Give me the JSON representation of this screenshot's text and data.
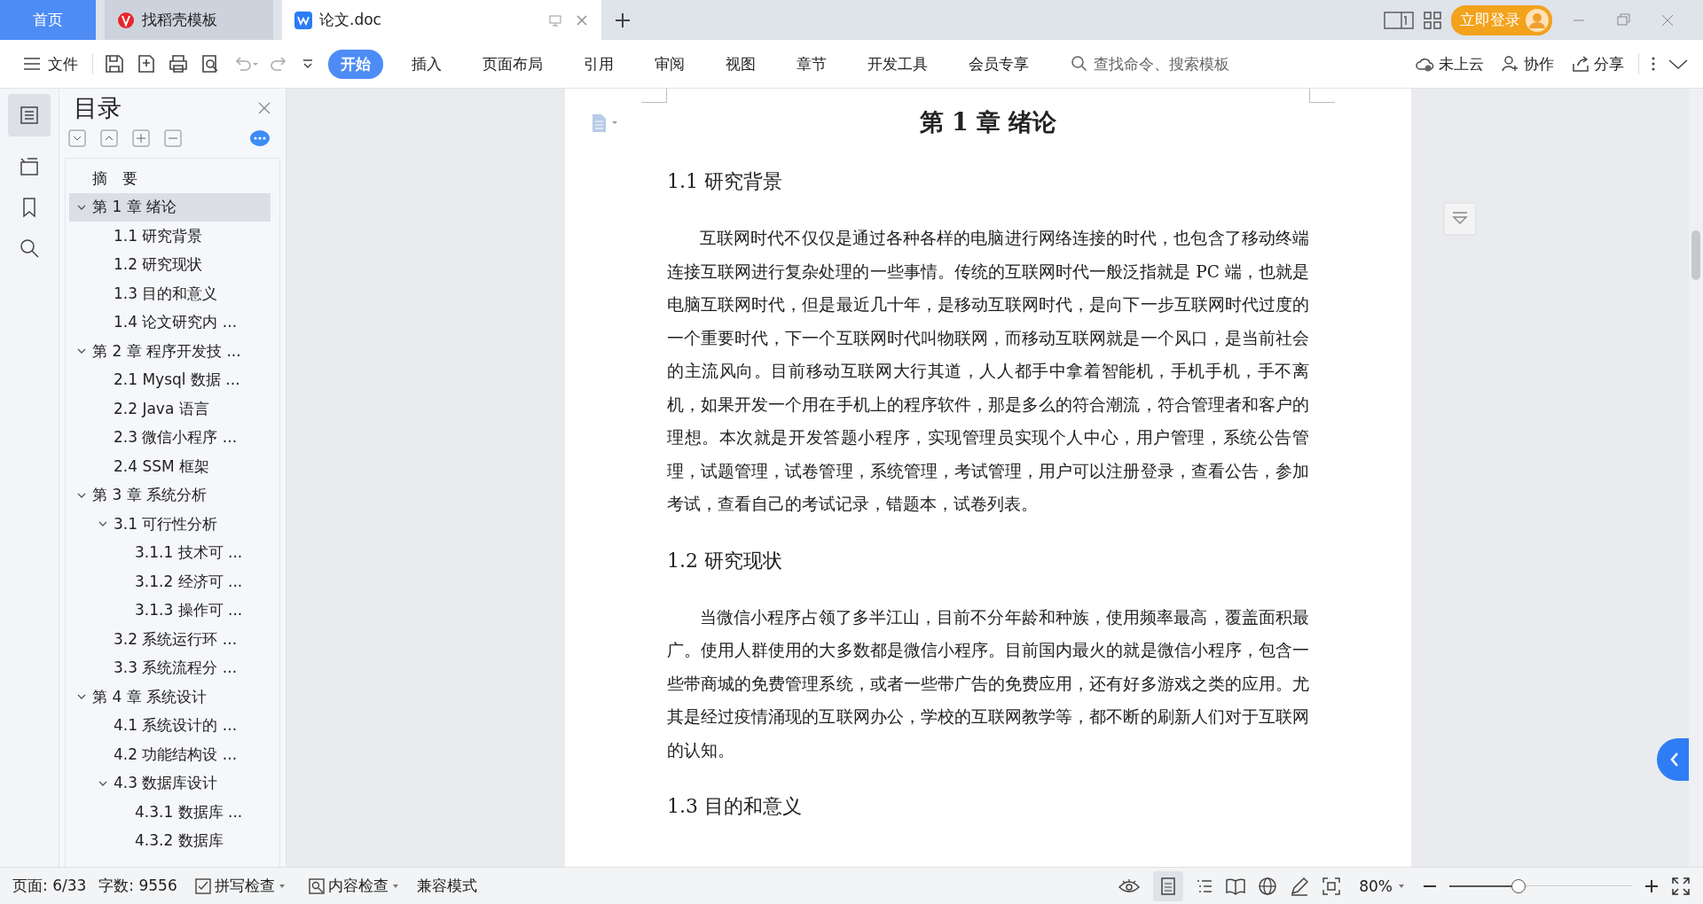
{
  "doc_tabs": [
    {
      "label": "首页",
      "kind": "home",
      "selected": false
    },
    {
      "label": "找稻壳模板",
      "kind": "template",
      "selected": false
    },
    {
      "label": "论文.doc",
      "kind": "document",
      "selected": true
    }
  ],
  "account": {
    "login": "立即登录"
  },
  "menu": {
    "file": "文件",
    "tabs": [
      {
        "label": "开始",
        "selected": true
      },
      {
        "label": "插入",
        "selected": false
      },
      {
        "label": "页面布局",
        "selected": false
      },
      {
        "label": "引用",
        "selected": false
      },
      {
        "label": "审阅",
        "selected": false
      },
      {
        "label": "视图",
        "selected": false
      },
      {
        "label": "章节",
        "selected": false
      },
      {
        "label": "开发工具",
        "selected": false
      },
      {
        "label": "会员专享",
        "selected": false
      }
    ],
    "search": {
      "placeholder": "查找命令、搜索模板"
    },
    "actions": [
      "未上云",
      "协作",
      "分享"
    ]
  },
  "toc": {
    "title": "目录",
    "items": [
      {
        "label": "摘　要",
        "selected": false
      },
      {
        "label": "第 1 章  绪论",
        "selected": true,
        "expanded": true,
        "children": [
          {
            "label": "1.1  研究背景",
            "selected": false
          },
          {
            "label": "1.2  研究现状",
            "selected": false
          },
          {
            "label": "1.3  目的和意义",
            "selected": false
          },
          {
            "label": "1.4  论文研究内 ...",
            "selected": false
          }
        ]
      },
      {
        "label": "第 2 章  程序开发技 ...",
        "selected": false,
        "expanded": true,
        "children": [
          {
            "label": "2.1 Mysql 数据 ...",
            "selected": false
          },
          {
            "label": "2.2 Java 语言",
            "selected": false
          },
          {
            "label": "2.3  微信小程序 ...",
            "selected": false
          },
          {
            "label": "2.4 SSM 框架",
            "selected": false
          }
        ]
      },
      {
        "label": "第 3 章  系统分析",
        "selected": false,
        "expanded": true,
        "children": [
          {
            "label": "3.1 可行性分析",
            "selected": false,
            "expanded": true,
            "children": [
              {
                "label": "3.1.1 技术可 ...",
                "selected": false
              },
              {
                "label": "3.1.2 经济可 ...",
                "selected": false
              },
              {
                "label": "3.1.3 操作可 ...",
                "selected": false
              }
            ]
          },
          {
            "label": "3.2 系统运行环 ...",
            "selected": false
          },
          {
            "label": "3.3 系统流程分 ...",
            "selected": false
          }
        ]
      },
      {
        "label": "第 4 章  系统设计",
        "selected": false,
        "expanded": true,
        "children": [
          {
            "label": "4.1  系统设计的 ...",
            "selected": false
          },
          {
            "label": "4.2  功能结构设 ...",
            "selected": false
          },
          {
            "label": "4.3  数据库设计",
            "selected": false,
            "expanded": true,
            "children": [
              {
                "label": "4.3.1  数据库  ...",
                "selected": false
              },
              {
                "label": "4.3.2  数据库",
                "selected": false
              }
            ]
          }
        ]
      }
    ]
  },
  "document": {
    "blocks": [
      {
        "kind": "chapter",
        "text": "第 1 章  绪论"
      },
      {
        "kind": "section",
        "text": "1.1  研究背景"
      },
      {
        "kind": "paragraph",
        "text": "互联网时代不仅仅是通过各种各样的电脑进行网络连接的时代，也包含了移动终端连接互联网进行复杂处理的一些事情。传统的互联网时代一般泛指就是 PC 端，也就是电脑互联网时代，但是最近几十年，是移动互联网时代，是向下一步互联网时代过度的一个重要时代，下一个互联网时代叫物联网，而移动互联网就是一个风口，是当前社会的主流风向。目前移动互联网大行其道，人人都手中拿着智能机，手机手机，手不离机，如果开发一个用在手机上的程序软件，那是多么的符合潮流，符合管理者和客户的理想。本次就是开发答题小程序，实现管理员实现个人中心，用户管理，系统公告管理，试题管理，试卷管理，系统管理，考试管理，用户可以注册登录，查看公告，参加考试，查看自己的考试记录，错题本，试卷列表。"
      },
      {
        "kind": "section",
        "text": "1.2  研究现状"
      },
      {
        "kind": "paragraph",
        "text": "当微信小程序占领了多半江山，目前不分年龄和种族，使用频率最高，覆盖面积最广。使用人群使用的大多数都是微信小程序。目前国内最火的就是微信小程序，包含一些带商城的免费管理系统，或者一些带广告的免费应用，还有好多游戏之类的应用。尤其是经过疫情涌现的互联网办公，学校的互联网教学等，都不断的刷新人们对于互联网的认知。"
      },
      {
        "kind": "section",
        "text": "1.3  目的和意义"
      }
    ]
  },
  "status_bar": {
    "page": "页面: 6/33",
    "words": "字数: 9556",
    "spell": "拼写检查",
    "content_check": "内容检查",
    "mode": "兼容模式",
    "zoom": "80%",
    "zoom_level": {
      "level": 0.38
    }
  }
}
